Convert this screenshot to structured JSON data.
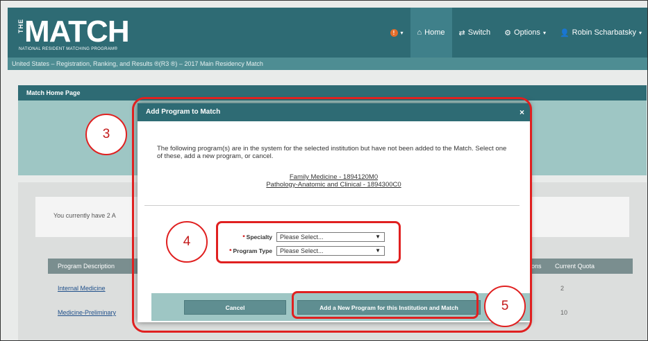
{
  "header": {
    "logo_the": "THE",
    "logo_match": "MATCH",
    "logo_tagline": "NATIONAL RESIDENT MATCHING PROGRAM®",
    "nav": {
      "alert_label": "!",
      "home": "Home",
      "switch": "Switch",
      "options": "Options",
      "user": "Robin Scharbatsky"
    }
  },
  "breadcrumb": "United States  –  Registration, Ranking, and Results ®(R3 ®)  –  2017 Main Residency Match",
  "background": {
    "panel_title": "Match Home Page",
    "info_text": "You currently have 2 A",
    "table": {
      "headers": [
        "Program Description",
        "ions",
        "Current Quota"
      ],
      "rows": [
        {
          "program": "Internal Medicine",
          "quota": "2"
        },
        {
          "program": "Medicine-Preliminary",
          "quota": "10"
        }
      ]
    }
  },
  "modal": {
    "title": "Add Program to Match",
    "close": "×",
    "message": "The following program(s) are in the system for the selected institution but have not been added to the Match. Select one of these, add a new program, or cancel.",
    "programs": [
      "Family Medicine - 1894120M0",
      "Pathology-Anatomic and Clinical - 1894300C0"
    ],
    "form": {
      "specialty_label": "Specialty",
      "specialty_value": "Please Select...",
      "program_type_label": "Program Type",
      "program_type_value": "Please Select..."
    },
    "buttons": {
      "cancel": "Cancel",
      "add_new": "Add a New Program for this Institution and Match"
    }
  },
  "callouts": [
    "3",
    "4",
    "5"
  ],
  "colors": {
    "header_teal": "#2e6b74",
    "footer_teal": "#9ec6c4",
    "callout_red": "#e02020"
  }
}
